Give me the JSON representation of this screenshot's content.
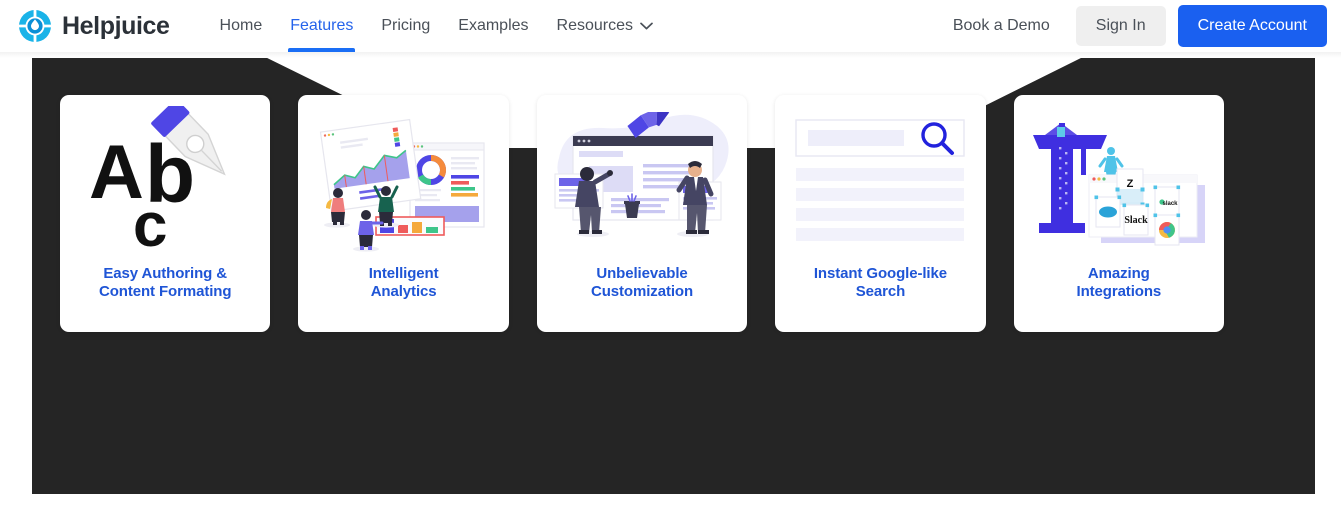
{
  "header": {
    "brand": {
      "name": "Helpjuice",
      "logo_icon": "helpjuice-lifering-droplet-logo"
    },
    "nav": [
      {
        "label": "Home",
        "active": false
      },
      {
        "label": "Features",
        "active": true
      },
      {
        "label": "Pricing",
        "active": false
      },
      {
        "label": "Examples",
        "active": false
      },
      {
        "label": "Resources",
        "active": false,
        "icon": "chevron-down-icon"
      }
    ],
    "actions": {
      "demo_label": "Book a Demo",
      "signin_label": "Sign In",
      "create_label": "Create Account"
    },
    "colors": {
      "accent_blue": "#1a60f0",
      "active_nav": "#2563eb",
      "signin_bg": "#efefef",
      "brand_text": "#2b3138"
    }
  },
  "section": {
    "background_color": "#252525",
    "notch": "white-v-notch-top-center"
  },
  "cards": [
    {
      "label": "Easy Authoring & Content Formating",
      "label_line1": "Easy Authoring &",
      "label_line2": "Content Formating",
      "art_icon": "abc-letters-pen-nib-illustration"
    },
    {
      "label": "Intelligent Analytics",
      "label_line1": "Intelligent",
      "label_line2": "Analytics",
      "art_icon": "dashboard-charts-people-illustration"
    },
    {
      "label": "Unbelievable Customization",
      "label_line1": "Unbelievable",
      "label_line2": "Customization",
      "art_icon": "browser-window-two-people-illustration"
    },
    {
      "label": "Instant Google-like Search",
      "label_line1": "Instant Google-like",
      "label_line2": "Search",
      "art_icon": "search-bar-magnifier-results-illustration"
    },
    {
      "label": "Amazing Integrations",
      "label_line1": "Amazing",
      "label_line2": "Integrations",
      "art_icon": "crane-integration-logos-illustration"
    }
  ]
}
